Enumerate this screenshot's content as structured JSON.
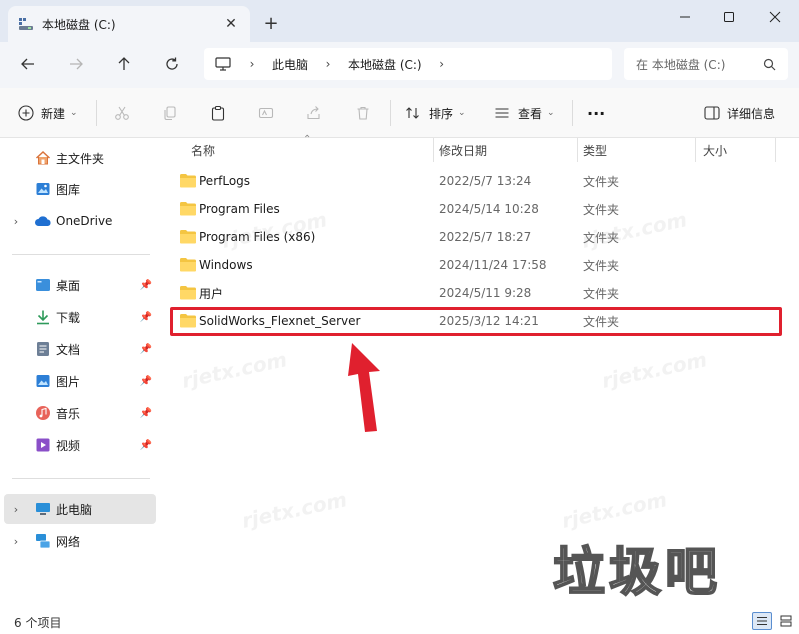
{
  "window": {
    "tab_title": "本地磁盘 (C:)",
    "close_tab": "✕",
    "new_tab": "+"
  },
  "address": {
    "segments": [
      "此电脑",
      "本地磁盘 (C:)"
    ],
    "search_placeholder": "在 本地磁盘 (C:)"
  },
  "toolbar": {
    "new_label": "新建",
    "sort_label": "排序",
    "view_label": "查看",
    "more_label": "···",
    "details_label": "详细信息"
  },
  "sidebar": {
    "items": [
      {
        "label": "主文件夹",
        "icon": "home-icon"
      },
      {
        "label": "图库",
        "icon": "gallery-icon"
      },
      {
        "label": "OneDrive",
        "icon": "cloud-icon"
      },
      {
        "label": "桌面",
        "icon": "desktop-icon"
      },
      {
        "label": "下载",
        "icon": "download-icon"
      },
      {
        "label": "文档",
        "icon": "document-icon"
      },
      {
        "label": "图片",
        "icon": "pictures-icon"
      },
      {
        "label": "音乐",
        "icon": "music-icon"
      },
      {
        "label": "视频",
        "icon": "video-icon"
      },
      {
        "label": "此电脑",
        "icon": "computer-icon"
      },
      {
        "label": "网络",
        "icon": "network-icon"
      }
    ]
  },
  "columns": {
    "name": "名称",
    "date": "修改日期",
    "type": "类型",
    "size": "大小"
  },
  "files": [
    {
      "name": "PerfLogs",
      "date": "2022/5/7 13:24",
      "type": "文件夹"
    },
    {
      "name": "Program Files",
      "date": "2024/5/14 10:28",
      "type": "文件夹"
    },
    {
      "name": "Program Files (x86)",
      "date": "2022/5/7 18:27",
      "type": "文件夹"
    },
    {
      "name": "Windows",
      "date": "2024/11/24 17:58",
      "type": "文件夹"
    },
    {
      "name": "用户",
      "date": "2024/5/11 9:28",
      "type": "文件夹"
    },
    {
      "name": "SolidWorks_Flexnet_Server",
      "date": "2025/3/12 14:21",
      "type": "文件夹"
    }
  ],
  "watermark": {
    "big_text": "垃圾吧",
    "repeat_text": "rjetx.com"
  },
  "status": {
    "count_text": "6 个项目"
  },
  "colors": {
    "accent": "#0067c0",
    "highlight": "#e0202e",
    "folder": "#f4c542"
  }
}
